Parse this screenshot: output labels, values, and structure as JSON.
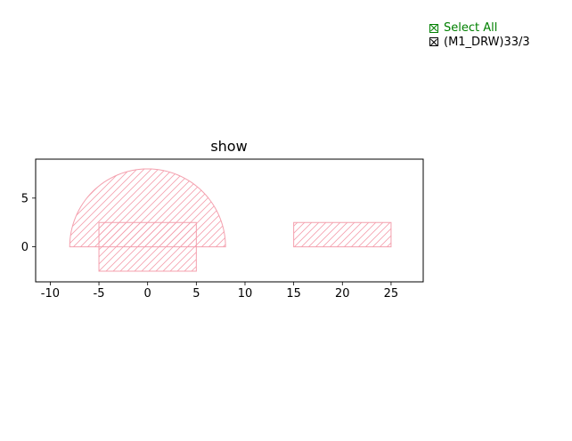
{
  "chart_data": {
    "type": "area",
    "title": "show",
    "xlabel": "",
    "ylabel": "",
    "xlim": [
      -11.5,
      28.3
    ],
    "ylim": [
      -3.6,
      9.0
    ],
    "xticks": [
      -10,
      -5,
      0,
      5,
      10,
      15,
      20,
      25
    ],
    "yticks": [
      0,
      5
    ],
    "grid": false,
    "legend_position": "top-right, outside plot",
    "series": [
      {
        "color": "#f4a0ae",
        "hatch": "diagonal",
        "shapes": [
          {
            "kind": "half-disc",
            "center": [
              0,
              0
            ],
            "radius": 8
          },
          {
            "kind": "rectangle",
            "x0": -5,
            "y0": -2.5,
            "x1": 5,
            "y1": 2.5
          },
          {
            "kind": "rectangle",
            "x0": 15,
            "y0": 0,
            "x1": 25,
            "y1": 2.5
          }
        ]
      }
    ]
  },
  "legend": {
    "select_all": "Select All",
    "layer": "(M1_DRW)33/3",
    "select_all_color": "#008000",
    "layer_color": "#000000",
    "checkbox_state": "checked"
  }
}
